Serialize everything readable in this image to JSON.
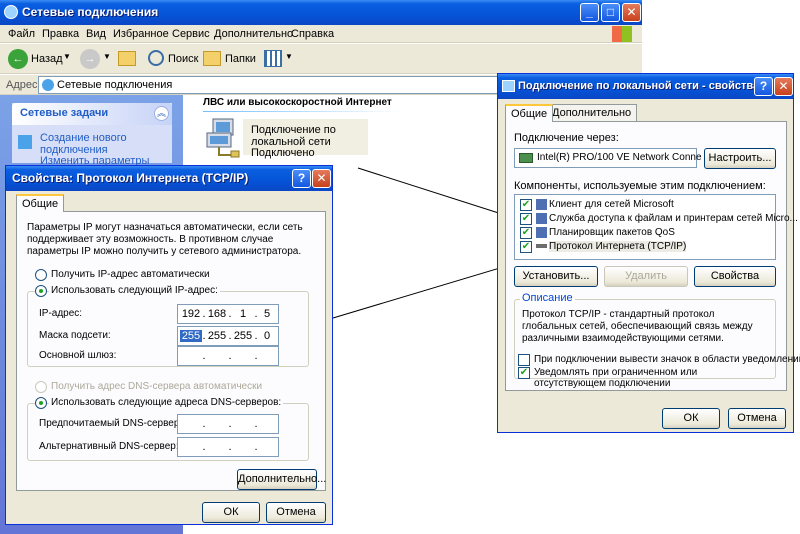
{
  "explorer": {
    "title": "Сетевые подключения",
    "menu": [
      "Файл",
      "Правка",
      "Вид",
      "Избранное",
      "Сервис",
      "Дополнительно",
      "Справка"
    ],
    "toolbar": {
      "back": "Назад",
      "search": "Поиск",
      "folders": "Папки"
    },
    "address_label": "Адрес:",
    "address_value": "Сетевые подключения",
    "side_header": "Сетевые задачи",
    "side_item_1": "Создание нового подключения",
    "side_item_2": "Изменить параметры",
    "section_title": "ЛВС или высокоскоростной Интернет",
    "connection_name": "Подключение по локальной сети",
    "connection_status": "Подключено"
  },
  "props": {
    "title": "Подключение по локальной сети - свойства",
    "tabs": [
      "Общие",
      "Дополнительно"
    ],
    "connect_via_label": "Подключение через:",
    "adapter": "Intel(R) PRO/100 VE Network Conne",
    "configure": "Настроить...",
    "components_label": "Компоненты, используемые этим подключением:",
    "components": [
      "Клиент для сетей Microsoft",
      "Служба доступа к файлам и принтерам сетей Micro...",
      "Планировщик пакетов QoS",
      "Протокол Интернета (TCP/IP)"
    ],
    "install": "Установить...",
    "remove": "Удалить",
    "properties": "Свойства",
    "desc_title": "Описание",
    "desc_text": "Протокол TCP/IP - стандартный протокол глобальных сетей, обеспечивающий связь между различными взаимодействующими сетями.",
    "show_icon": "При подключении вывести значок в области уведомлений",
    "notify": "Уведомлять при ограниченном или отсутствующем подключении",
    "ok": "ОК",
    "cancel": "Отмена"
  },
  "tcpip": {
    "title": "Свойства: Протокол Интернета (TCP/IP)",
    "tab": "Общие",
    "intro": "Параметры IP могут назначаться автоматически, если сеть поддерживает эту возможность. В противном случае параметры IP можно получить у сетевого администратора.",
    "auto_ip": "Получить IP-адрес автоматически",
    "manual_ip": "Использовать следующий IP-адрес:",
    "ip_label": "IP-адрес:",
    "ip": [
      "192",
      "168",
      "1",
      "5"
    ],
    "mask_label": "Маска подсети:",
    "mask": [
      "255",
      "255",
      "255",
      "0"
    ],
    "gateway_label": "Основной шлюз:",
    "auto_dns": "Получить адрес DNS-сервера автоматически",
    "manual_dns": "Использовать следующие адреса DNS-серверов:",
    "dns1_label": "Предпочитаемый DNS-сервер:",
    "dns2_label": "Альтернативный DNS-сервер:",
    "advanced": "Дополнительно...",
    "ok": "ОК",
    "cancel": "Отмена"
  }
}
